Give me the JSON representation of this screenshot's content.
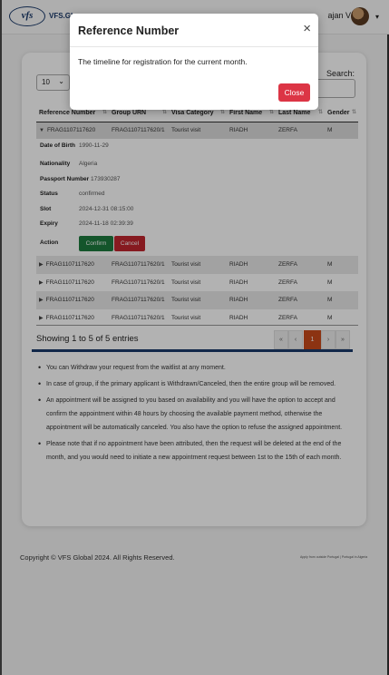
{
  "navbar": {
    "logo_text": "vfs",
    "brand": "VFS.GL",
    "user_name": "ajan V",
    "caret": "▾"
  },
  "table_controls": {
    "page_length": "10",
    "search_label": "Search:",
    "search_value": ""
  },
  "table": {
    "columns": [
      "Reference Number",
      "Group URN",
      "Visa Category",
      "First Name",
      "Last Name",
      "Gender"
    ],
    "expanded_row": {
      "reference": "FRAG1107117620",
      "group_urn": "FRAG1107117620/1",
      "visa_category": "Tourist visit",
      "first_name": "RIADH",
      "last_name": "ZERFA",
      "gender": "M"
    },
    "details": [
      {
        "label": "Date of Birth",
        "value": "1990-11-29"
      },
      {
        "label": "Nationality",
        "value": "Algeria"
      },
      {
        "label": "Passport Number",
        "value": "173930287"
      },
      {
        "label": "Status",
        "value": "confirmed"
      },
      {
        "label": "Slot",
        "value": "2024-12-31 08:15:00"
      },
      {
        "label": "Expiry",
        "value": "2024-11-18 02:39:39"
      },
      {
        "label": "Action",
        "value": ""
      }
    ],
    "confirm_label": "Confirm",
    "cancel_label": "Cancel",
    "rows": [
      {
        "reference": "FRAG1107117620",
        "group_urn": "FRAG1107117620/1",
        "visa_category": "Tourist visit",
        "first_name": "RIADH",
        "last_name": "ZERFA",
        "gender": "M"
      },
      {
        "reference": "FRAG1107117620",
        "group_urn": "FRAG1107117620/1",
        "visa_category": "Tourist visit",
        "first_name": "RIADH",
        "last_name": "ZERFA",
        "gender": "M"
      },
      {
        "reference": "FRAG1107117620",
        "group_urn": "FRAG1107117620/1",
        "visa_category": "Tourist visit",
        "first_name": "RIADH",
        "last_name": "ZERFA",
        "gender": "M"
      },
      {
        "reference": "FRAG1107117620",
        "group_urn": "FRAG1107117620/1",
        "visa_category": "Tourist visit",
        "first_name": "RIADH",
        "last_name": "ZERFA",
        "gender": "M"
      }
    ],
    "info": "Showing 1 to 5 of 5 entries",
    "pager": {
      "first": "«",
      "prev": "‹",
      "current": "1",
      "next": "›",
      "last": "»"
    }
  },
  "notes": [
    "You can Withdraw your request from the waitlist at any moment.",
    "In case of group, if the primary applicant is Withdrawn/Canceled, then the entire group will be removed.",
    "An appointment will be assigned to you based on availability and you will have the option to accept and confirm the appointment within 48 hours by choosing the available payment method, otherwise the appointment will be automatically canceled. You also have the option to refuse the assigned appointment.",
    "Please note that if no appointment have been attributed, then the request will be deleted at the end of the month, and you would need to initiate a new appointment request between 1st to the 15th of each month."
  ],
  "footer": {
    "copyright": "Copyright © VFS Global 2024. All Rights Reserved.",
    "right_text": "Apply from outside Portugal | Portugal in Algeria"
  },
  "modal": {
    "title": "Reference Number",
    "close_glyph": "×",
    "body": "The timeline for registration for the current month.",
    "close_button": "Close"
  },
  "colors": {
    "modal_close_button": "#dc3545",
    "confirm": "#1e7a3e",
    "cancel": "#c0262f",
    "pager_active": "#c94a1a",
    "brand_blue": "#1b3a6b"
  }
}
